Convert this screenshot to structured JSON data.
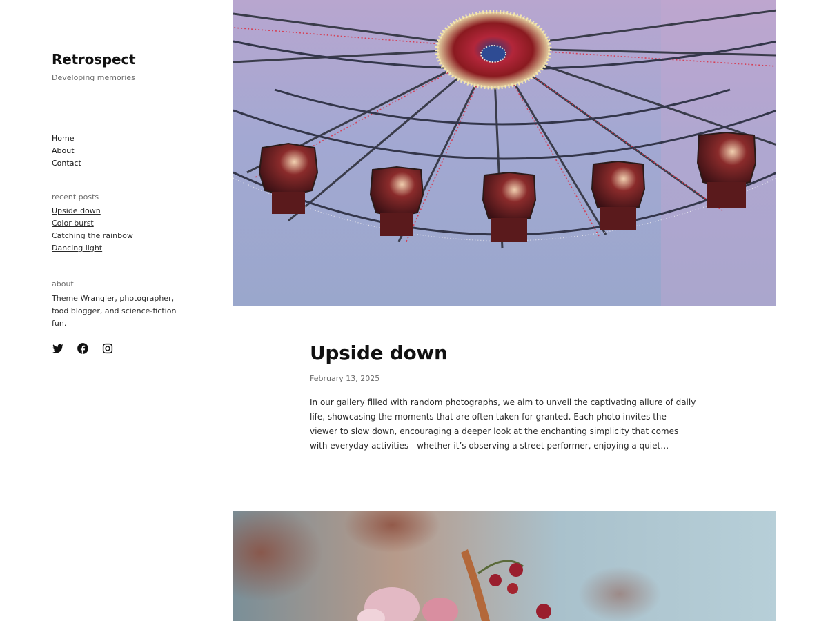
{
  "site": {
    "title": "Retrospect",
    "tagline": "Developing memories"
  },
  "nav": {
    "items": [
      {
        "label": "Home"
      },
      {
        "label": "About"
      },
      {
        "label": "Contact"
      }
    ]
  },
  "recent_posts": {
    "heading": "recent posts",
    "items": [
      {
        "label": "Upside down"
      },
      {
        "label": "Color burst"
      },
      {
        "label": "Catching the rainbow"
      },
      {
        "label": "Dancing light"
      }
    ]
  },
  "about": {
    "heading": "about",
    "text": "Theme Wrangler, photographer, food blogger, and science-fiction fun."
  },
  "social": {
    "icons": [
      "twitter-icon",
      "facebook-icon",
      "instagram-icon"
    ]
  },
  "post": {
    "title": "Upside down",
    "date": "February 13, 2025",
    "excerpt": "In our gallery filled with random photographs, we aim to unveil the captivating allure of daily life, showcasing the moments that are often taken for granted. Each photo invites the viewer to slow down, encouraging a deeper look at the enchanting simplicity that comes with everyday activities—whether it’s observing a street performer, enjoying a quiet…"
  },
  "colors": {
    "text": "#1e1e1e",
    "muted": "#6b6b6b",
    "border": "#e6e6e6"
  }
}
